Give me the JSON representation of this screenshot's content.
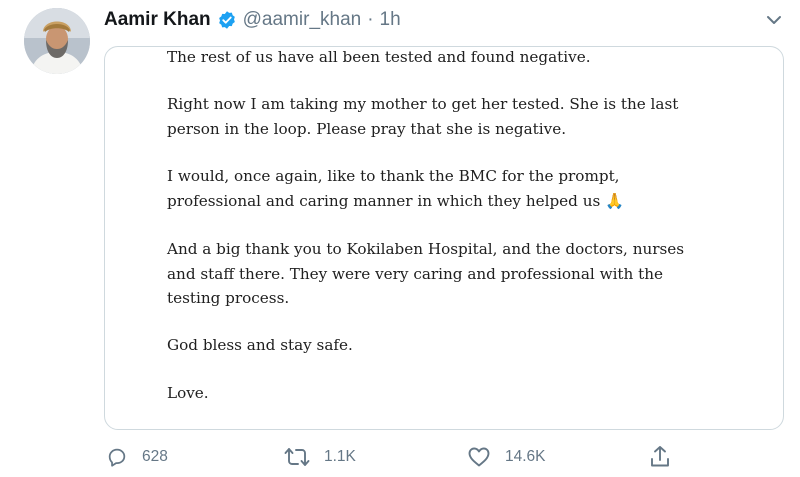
{
  "colors": {
    "verified_badge": "#1da1f2",
    "secondary_text": "#657786",
    "primary_text": "#14171a",
    "border": "#cfd9de"
  },
  "tweet": {
    "author": {
      "display_name": "Aamir Khan",
      "handle": "@aamir_khan",
      "verified": true,
      "avatar_icon": "person-avatar-icon"
    },
    "separator": "·",
    "time": "1h",
    "menu_icon": "chevron-down-icon",
    "note_paragraphs": [
      [
        "The rest of us have all been tested and found negative."
      ],
      [
        "Right now I am taking my mother to get her tested. She is the last",
        "person in the loop. Please pray that she is negative."
      ],
      [
        "I would, once again, like to thank the BMC for the prompt,",
        "professional and caring manner in which they helped us 🙏"
      ],
      [
        "And a big thank you to Kokilaben Hospital, and the doctors, nurses",
        "and staff there. They were very caring and professional with the",
        "testing process."
      ],
      [
        "God bless and stay safe."
      ],
      [
        "Love."
      ]
    ],
    "actions": {
      "reply": {
        "icon": "reply-icon",
        "count": "628"
      },
      "retweet": {
        "icon": "retweet-icon",
        "count": "1.1K"
      },
      "like": {
        "icon": "heart-icon",
        "count": "14.6K"
      },
      "share": {
        "icon": "share-icon",
        "count": ""
      }
    }
  }
}
